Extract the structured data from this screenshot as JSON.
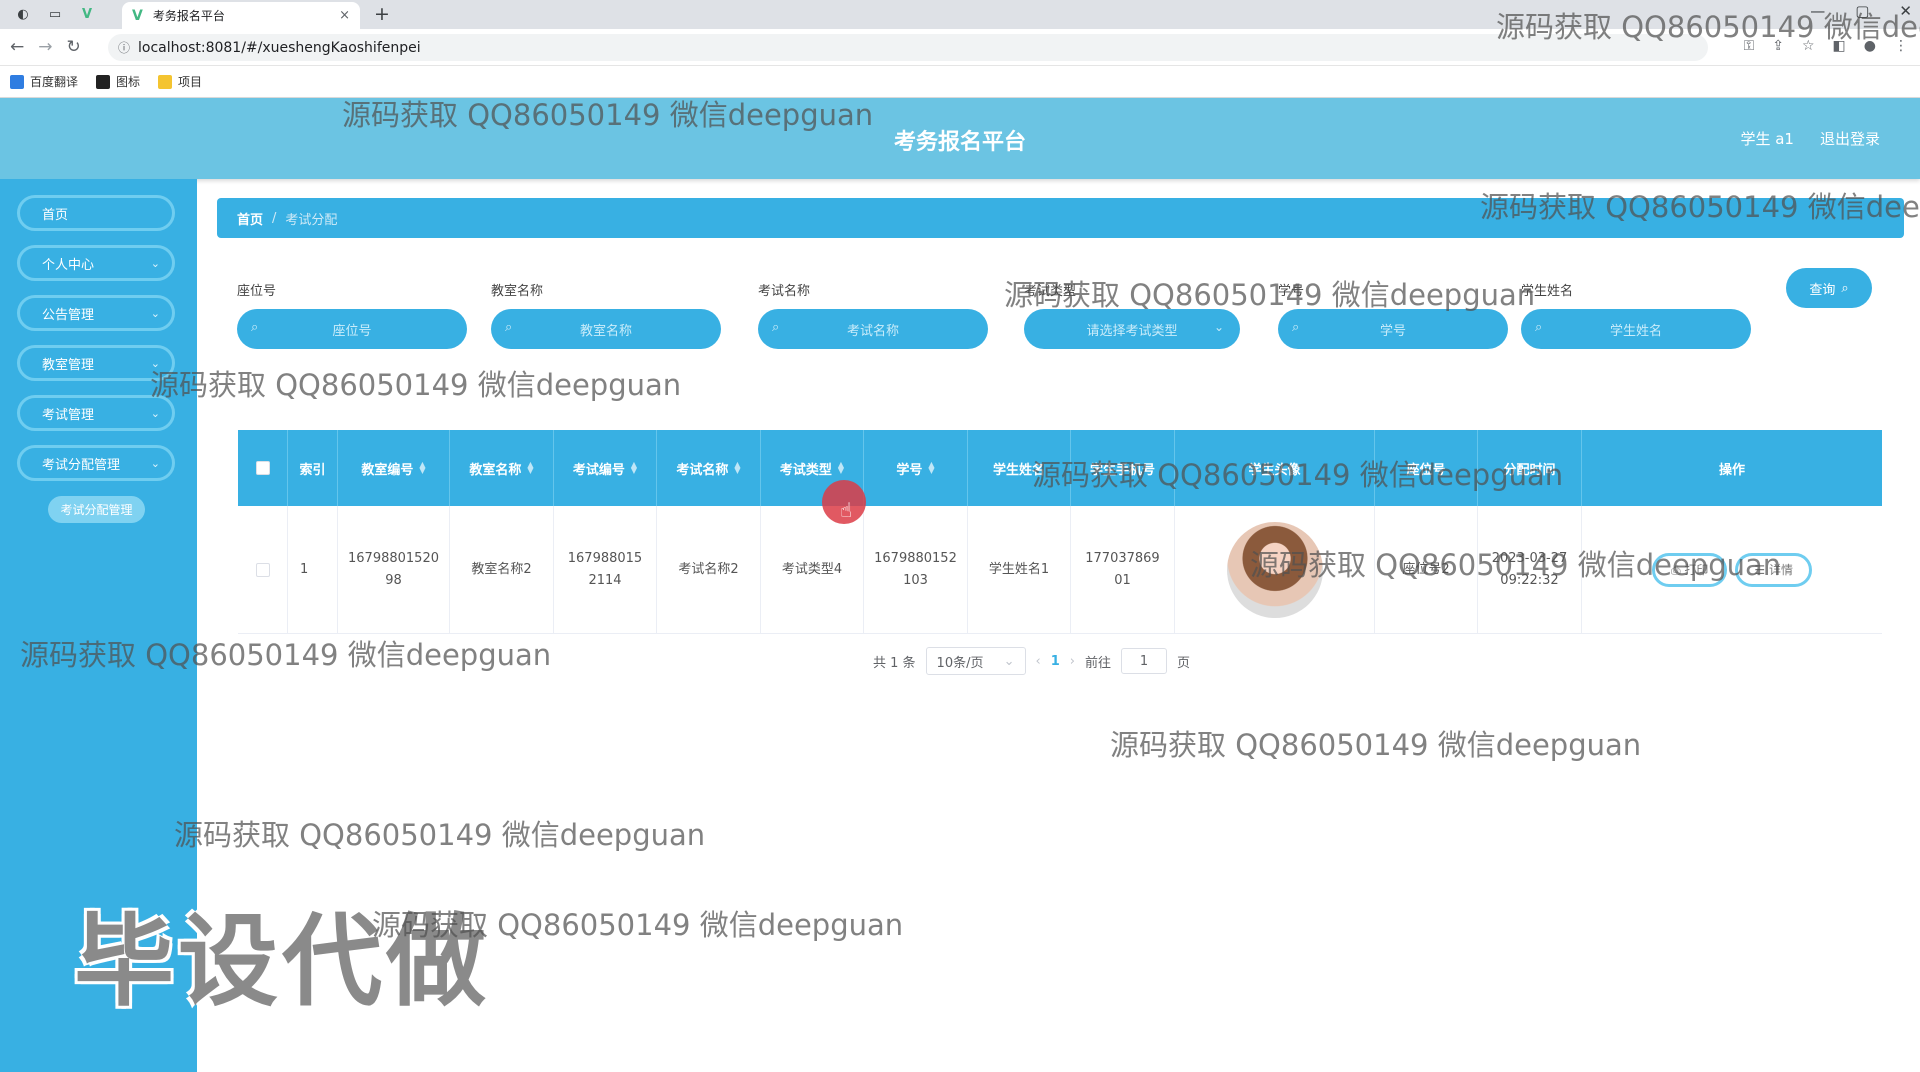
{
  "browser": {
    "tab_title": "考务报名平台",
    "tab_close": "×",
    "new_tab": "+",
    "url": "localhost:8081/#/xueshengKaoshifenpei",
    "bookmarks": [
      "百度翻译",
      "图标",
      "项目"
    ]
  },
  "app": {
    "title": "考务报名平台",
    "user_label": "学生 a1",
    "logout_label": "退出登录"
  },
  "sidebar": {
    "items": [
      "首页",
      "个人中心",
      "公告管理",
      "教室管理",
      "考试管理",
      "考试分配管理"
    ],
    "active_sub": "考试分配管理"
  },
  "breadcrumb": {
    "home": "首页",
    "sep": "/",
    "current": "考试分配"
  },
  "search": {
    "fields": [
      {
        "label": "座位号",
        "placeholder": "座位号"
      },
      {
        "label": "教室名称",
        "placeholder": "教室名称"
      },
      {
        "label": "考试名称",
        "placeholder": "考试名称"
      },
      {
        "label": "考试类型",
        "placeholder": "请选择考试类型"
      },
      {
        "label": "学号",
        "placeholder": "学号"
      },
      {
        "label": "学生姓名",
        "placeholder": "学生姓名"
      }
    ],
    "query_label": "查询"
  },
  "table": {
    "headers": [
      "索引",
      "教室编号",
      "教室名称",
      "考试编号",
      "考试名称",
      "考试类型",
      "学号",
      "学生姓名",
      "学生手机号",
      "学生头像",
      "座位号",
      "分配时间",
      "操作"
    ],
    "rows": [
      {
        "index": "1",
        "classroom_no": "1679880152098",
        "classroom_name": "教室名称2",
        "exam_no": "1679880152114",
        "exam_name": "考试名称2",
        "exam_type": "考试类型4",
        "student_no": "1679880152103",
        "student_name": "学生姓名1",
        "phone": "17703786901",
        "seat": "座位号2",
        "assign_date": "2023-03-27",
        "assign_time": "09:22:32",
        "print_label": "打印",
        "detail_label": "详情"
      }
    ]
  },
  "pagination": {
    "total": "共 1 条",
    "page_size": "10条/页",
    "current_page": "1",
    "goto_label": "前往",
    "goto_value": "1",
    "page_suffix": "页"
  },
  "watermarks": {
    "text": "源码获取 QQ86050149 微信deepguan",
    "big": "毕设代做"
  }
}
